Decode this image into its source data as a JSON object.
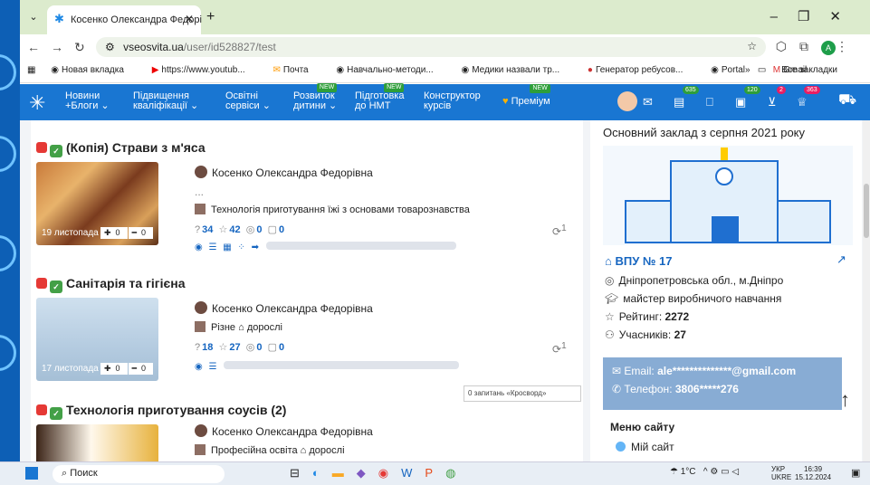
{
  "browser": {
    "tab_title": "Косенко Олександра Федорі",
    "url_host": "vseosvita.ua",
    "url_path": "/user/id528827/test",
    "bookmarks": [
      "Новая вкладка",
      "https://www.youtub...",
      "Почта",
      "Навчально-методи...",
      "Медики назвали тр...",
      "Генератор ребусов...",
      "Portal",
      "Gmail"
    ],
    "all_bookmarks": "Все закладки",
    "profile_letter": "A"
  },
  "site_nav": {
    "items": [
      {
        "label": "Новини\n+Блоги",
        "new": false
      },
      {
        "label": "Підвищення\nкваліфікації",
        "new": false
      },
      {
        "label": "Освітні\nсервіси",
        "new": false
      },
      {
        "label": "Розвиток\nдитини",
        "new": true
      },
      {
        "label": "Підготовка\nдо НМТ",
        "new": true
      },
      {
        "label": "Конструктор\nкурсів",
        "new": false
      },
      {
        "label": "Преміум",
        "new": true
      }
    ],
    "new_label": "NEW",
    "badges": [
      "635",
      "120",
      "2",
      "363"
    ]
  },
  "cards": [
    {
      "title": "(Копія) Страви з м'яса",
      "author": "Косенко Олександра Федорівна",
      "extra": "...",
      "subject": "Технологія приготування їжі з основами товарознавства",
      "date": "19 листопада",
      "plus": "0",
      "minus": "0",
      "questions": "34",
      "stars": "42",
      "views": "0",
      "comments": "0",
      "shares": "1"
    },
    {
      "title": "Санітарія та гігієна",
      "author": "Косенко Олександра Федорівна",
      "subject": "Різне",
      "audience": "дорослі",
      "date": "17 листопада",
      "plus": "0",
      "minus": "0",
      "questions": "18",
      "stars": "27",
      "views": "0",
      "comments": "0",
      "shares": "1"
    },
    {
      "title": "Технологія приготування соусів (2)",
      "author": "Косенко Олександра Федорівна",
      "subject": "Професійна освіта",
      "audience": "дорослі"
    }
  ],
  "tooltip": "0 запитань «Кросворд»",
  "sidebar": {
    "header": "Основний заклад з серпня 2021 року",
    "institution": "ВПУ № 17",
    "location": "Дніпропетровська обл., м.Дніпро",
    "position": "майстер виробничого навчання",
    "rating_label": "Рейтинг:",
    "rating": "2272",
    "members_label": "Учасників:",
    "members": "27",
    "email_label": "Email:",
    "email": "ale**************@gmail.com",
    "phone_label": "Телефон:",
    "phone": "3806*****276",
    "menu_title": "Меню сайту",
    "menu_item": "Мій сайт"
  },
  "taskbar": {
    "search": "Поиск",
    "weather": "1°C",
    "lang1": "УКР",
    "lang2": "UKRE",
    "time": "16:39",
    "date": "15.12.2024"
  }
}
